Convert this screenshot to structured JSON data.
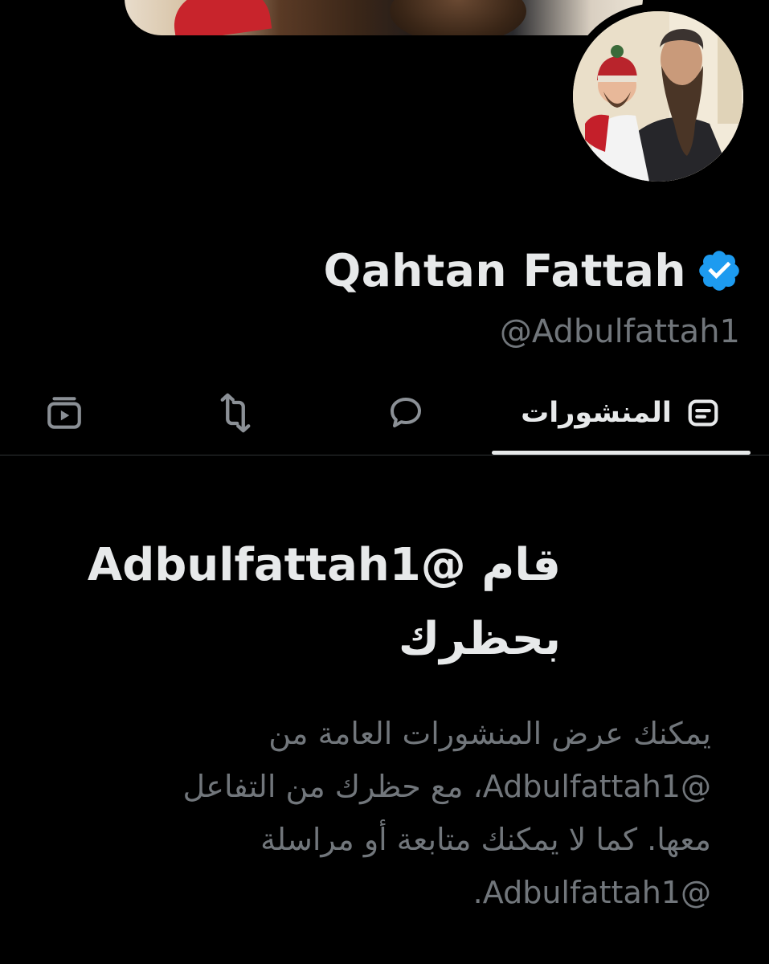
{
  "profile": {
    "display_name": "Qahtan Fattah",
    "handle": "@Adbulfattah1",
    "verified": true,
    "verified_icon": "verified-badge-icon",
    "verified_color": "#1d9bf0"
  },
  "tabs": [
    {
      "id": "posts",
      "label": "المنشورات",
      "icon": "posts-icon",
      "selected": true
    },
    {
      "id": "replies",
      "label": "",
      "icon": "comment-icon",
      "selected": false
    },
    {
      "id": "reposts",
      "label": "",
      "icon": "repost-icon",
      "selected": false
    },
    {
      "id": "media",
      "label": "",
      "icon": "video-icon",
      "selected": false
    }
  ],
  "blocked": {
    "title": "قام @Adbulfattah1 بحظرك",
    "body_lines": [
      "يمكنك عرض المنشورات العامة من",
      "@Adbulfattah1، مع حظرك من التفاعل",
      "معها. كما لا يمكنك متابعة أو مراسلة",
      "@Adbulfattah1."
    ]
  },
  "colors": {
    "background": "#000000",
    "primary_text": "#e7e9ea",
    "secondary_text": "#71767b",
    "divider": "#2f3336",
    "accent": "#1d9bf0"
  }
}
